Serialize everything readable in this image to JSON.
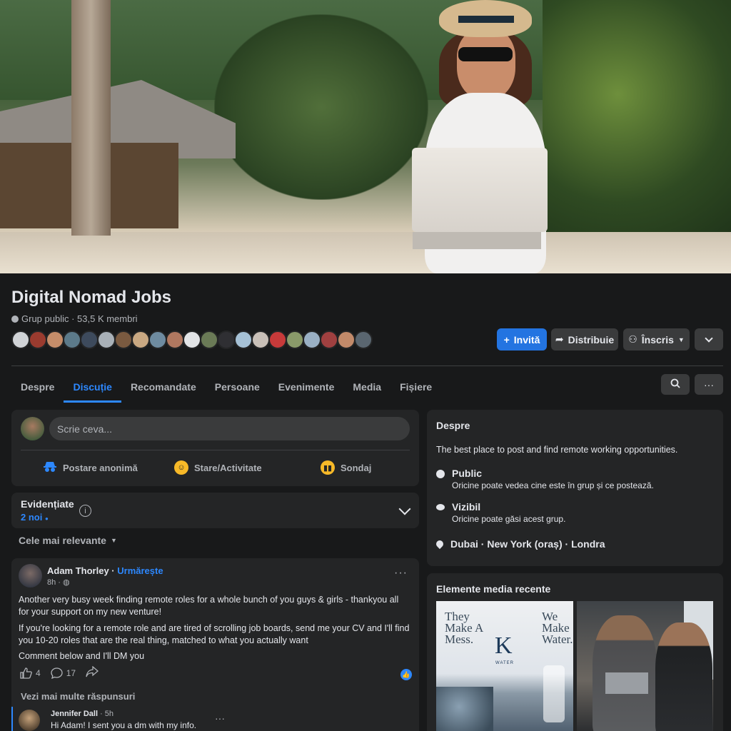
{
  "group": {
    "name": "Digital Nomad Jobs",
    "meta": "Grup public · 53,5 K membri",
    "member_avatar_colors": [
      "#d0d3d6",
      "#9a3b2f",
      "#c58d6a",
      "#5c7a8a",
      "#3d4a5c",
      "#a9b1b8",
      "#7a5a40",
      "#c9a882",
      "#6e8ba0",
      "#b07860",
      "#e2e4e6",
      "#6a7a56",
      "#2f2f33",
      "#a6c1d6",
      "#c9c0b8",
      "#c73a3a",
      "#8a9a6a",
      "#9ab0c4",
      "#a04040",
      "#c28a6a",
      "#5a6670"
    ]
  },
  "header_buttons": {
    "invite": "Invită",
    "share": "Distribuie",
    "joined": "Înscris"
  },
  "tabs": [
    "Despre",
    "Discuție",
    "Recomandate",
    "Persoane",
    "Evenimente",
    "Media",
    "Fișiere"
  ],
  "active_tab": "Discuție",
  "composer": {
    "placeholder": "Scrie ceva...",
    "actions": [
      {
        "label": "Postare anonimă",
        "icon": "incognito-icon",
        "color": "#2d88ff"
      },
      {
        "label": "Stare/Activitate",
        "icon": "smiley-icon",
        "color": "#f7b928"
      },
      {
        "label": "Sondaj",
        "icon": "poll-icon",
        "color": "#f7b928"
      }
    ]
  },
  "highlights": {
    "title": "Evidențiate",
    "new_count": "2 noi"
  },
  "sort": "Cele mai relevante",
  "post": {
    "author": "Adam Thorley",
    "follow": "Urmărește",
    "time": "8h · ",
    "p1": "Another very busy week finding remote roles for a whole bunch of you guys & girls - thankyou all for your support on my new venture!",
    "p2": "If you're looking for a remote role and are tired of scrolling job boards, send me your CV and I'll find you 10-20 roles that are the real thing, matched to what you actually want",
    "p3": "Comment below and I'll DM you",
    "likes": "4",
    "comments": "17",
    "more_replies": "Vezi mai multe răspunsuri",
    "reply": {
      "author": "Jennifer Dall",
      "time": " · 5h",
      "text": "Hi Adam! I sent you a dm with my info."
    }
  },
  "about": {
    "title": "Despre",
    "description": "The best place to post and find remote working opportunities.",
    "public_title": "Public",
    "public_sub": "Oricine poate vedea cine este în grup și ce postează.",
    "visible_title": "Vizibil",
    "visible_sub": "Oricine poate găsi acest grup.",
    "location": "Dubai · New York (oraș) · Londra"
  },
  "media": {
    "title": "Elemente media recente",
    "img1_left": "They Make A Mess.",
    "img1_right": "We Make Water.",
    "img1_logo": "K",
    "img1_logo_word": "WATER"
  }
}
